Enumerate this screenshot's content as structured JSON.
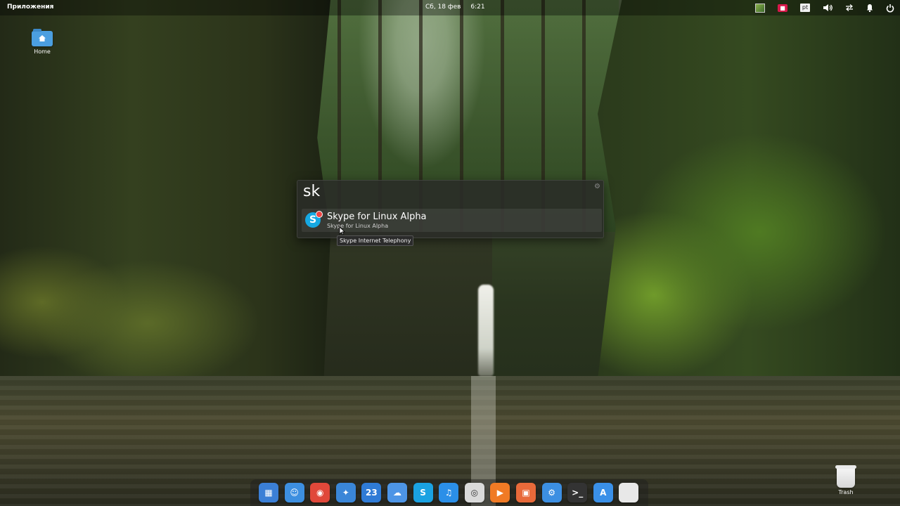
{
  "topbar": {
    "applications_label": "Приложения",
    "date": "Сб, 18 фев",
    "time": "6:21",
    "tray": {
      "indicator_label": "■",
      "language": "pt"
    }
  },
  "desktop": {
    "home_label": "Home",
    "trash_label": "Trash"
  },
  "launcher": {
    "query": "sk",
    "results": [
      {
        "title": "Skype for Linux Alpha",
        "subtitle": "Skype for Linux Alpha",
        "icon_letter": "S"
      }
    ],
    "tooltip": "Skype Internet Telephony"
  },
  "dock": {
    "items": [
      {
        "name": "multitasking-view-icon",
        "glyph": "▦",
        "color": "#3b7fd6"
      },
      {
        "name": "files-icon",
        "glyph": "☺",
        "color": "#3d8fe0"
      },
      {
        "name": "chrome-icon",
        "glyph": "◉",
        "color": "#e0483a"
      },
      {
        "name": "maps-icon",
        "glyph": "✦",
        "color": "#3a86d8"
      },
      {
        "name": "calendar-icon",
        "glyph": "23",
        "color": "#2f7bd6"
      },
      {
        "name": "chat-icon",
        "glyph": "☁",
        "color": "#4d95e6"
      },
      {
        "name": "skype-icon",
        "glyph": "S",
        "color": "#1aa2e2"
      },
      {
        "name": "music-icon",
        "glyph": "♫",
        "color": "#2b8fe8"
      },
      {
        "name": "camera-icon",
        "glyph": "◎",
        "color": "#dadada"
      },
      {
        "name": "video-icon",
        "glyph": "▶",
        "color": "#f07a25"
      },
      {
        "name": "photos-icon",
        "glyph": "▣",
        "color": "#e86a3a"
      },
      {
        "name": "settings-icon",
        "glyph": "⚙",
        "color": "#3c8fe2"
      },
      {
        "name": "terminal-icon",
        "glyph": ">_",
        "color": "#333333"
      },
      {
        "name": "appcenter-icon",
        "glyph": "A",
        "color": "#3a90e8"
      },
      {
        "name": "trash-dock-icon",
        "glyph": "",
        "color": "#e8e8e8"
      }
    ]
  }
}
